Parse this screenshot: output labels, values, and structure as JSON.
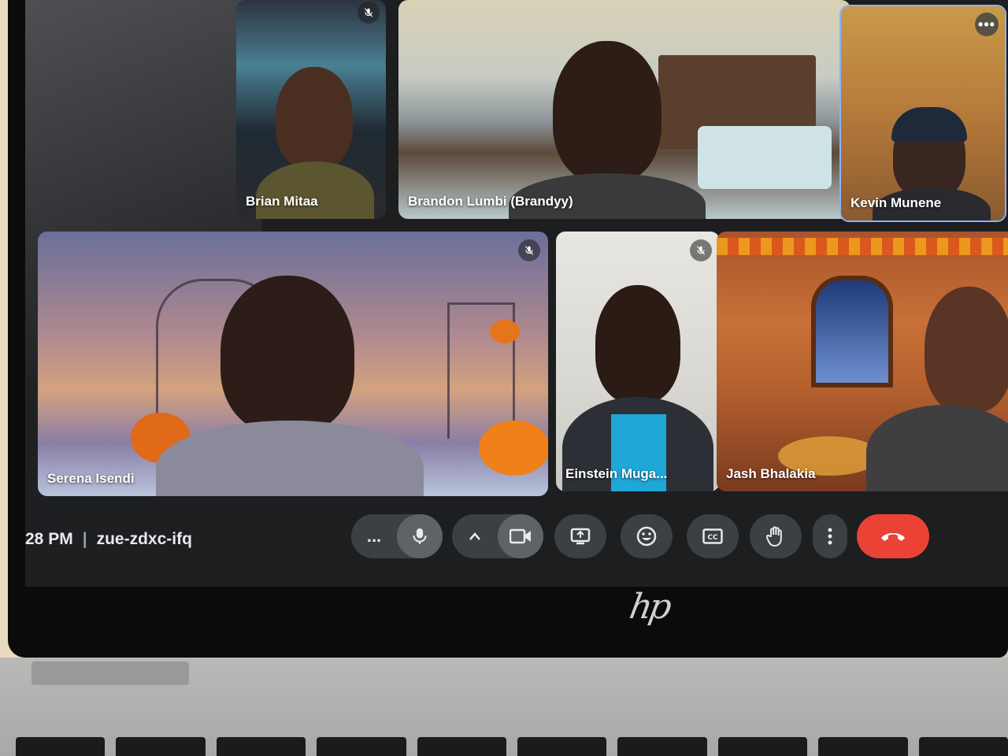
{
  "meeting": {
    "time": "28 PM",
    "separator": "|",
    "code": "zue-zdxc-ifq"
  },
  "participants": [
    {
      "name": "Brian Mitaa",
      "muted": true
    },
    {
      "name": "Brandon Lumbi (Brandyy)",
      "muted": false
    },
    {
      "name": "Kevin Munene",
      "muted": false
    },
    {
      "name": "Serena Isendi",
      "muted": true
    },
    {
      "name": "Einstein Muga...",
      "muted": true
    },
    {
      "name": "Jash Bhalakia",
      "muted": false
    }
  ],
  "controls": {
    "more_label": "...",
    "icons": [
      "more-options-icon",
      "microphone-icon",
      "chevron-up-icon",
      "camera-icon",
      "present-screen-icon",
      "emoji-icon",
      "captions-icon",
      "raise-hand-icon",
      "vertical-dots-icon",
      "end-call-icon"
    ]
  },
  "device": {
    "logo": "hp"
  },
  "colors": {
    "end_call": "#ea4335",
    "control_bg": "#3c4043",
    "screen_bg": "#1d1e20"
  }
}
